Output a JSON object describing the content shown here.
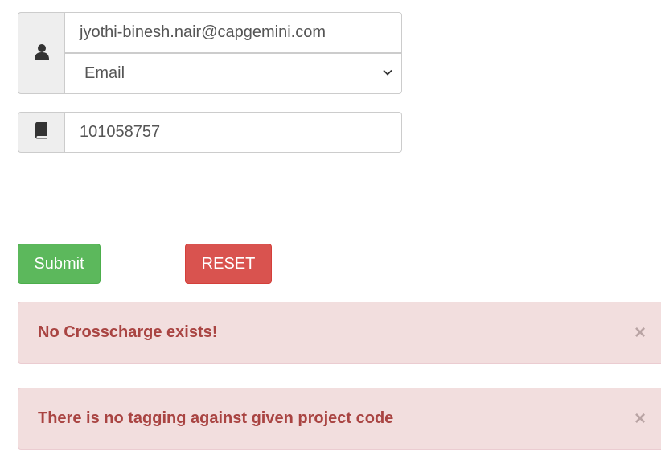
{
  "form": {
    "identifier_value": "jyothi-binesh.nair@capgemini.com",
    "identifier_type": "Email",
    "project_code": "101058757",
    "user_icon": "user-icon",
    "book_icon": "book-icon"
  },
  "buttons": {
    "submit": "Submit",
    "reset": "RESET"
  },
  "alerts": [
    {
      "message": "No Crosscharge exists!",
      "close": "×"
    },
    {
      "message": "There is no tagging against given project code",
      "close": "×"
    }
  ],
  "colors": {
    "submit": "#5cb85c",
    "reset": "#d9534f",
    "alert_bg": "#f2dede",
    "alert_text": "#a94442"
  }
}
